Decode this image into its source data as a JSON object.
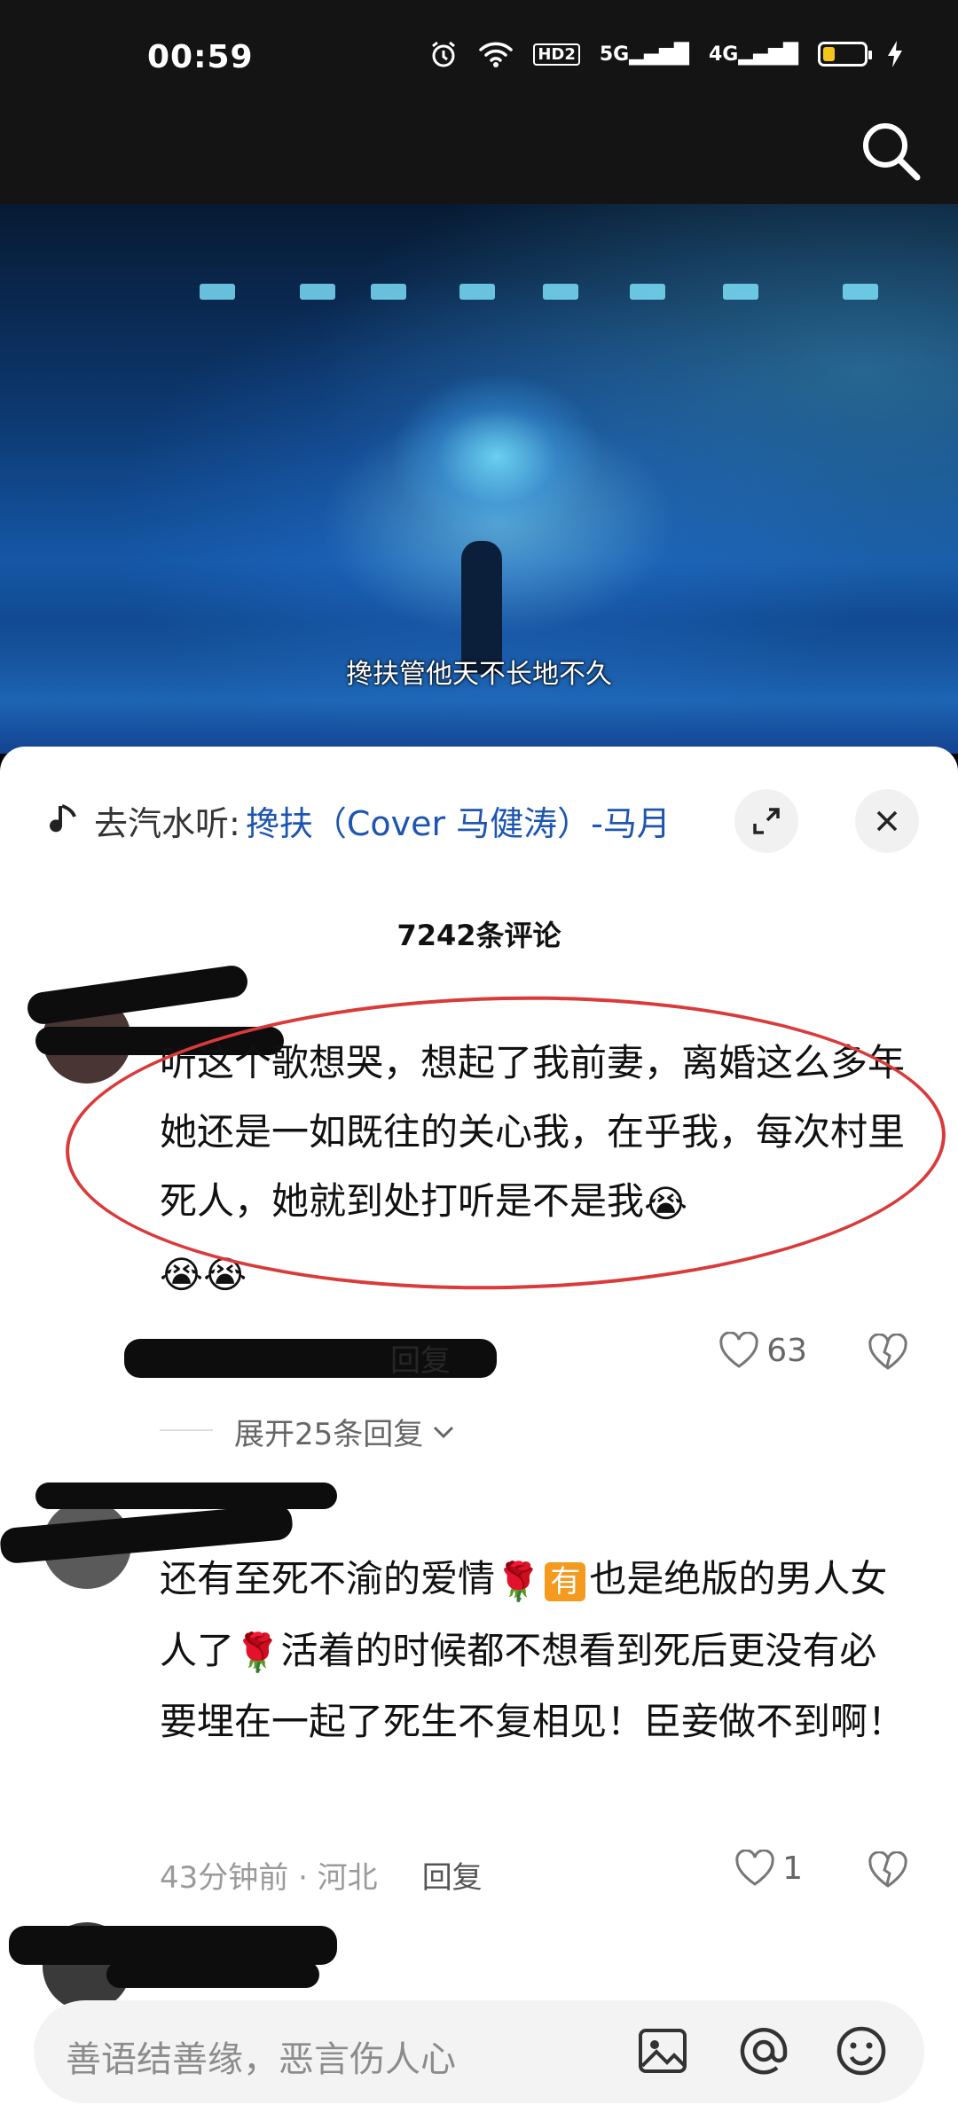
{
  "status": {
    "time": "00:59",
    "hd": "HD2",
    "net1": "5G",
    "net2": "4G",
    "battery_level": 0.3
  },
  "video": {
    "subtitle": "搀扶管他天不长地不久"
  },
  "music": {
    "prefix": "去汽水听:",
    "title": "搀扶（Cover 马健涛）-马月"
  },
  "comments": {
    "count_label": "7242条评论",
    "items": [
      {
        "text": "听这个歌想哭，想起了我前妻，离婚这么多年她还是一如既往的关心我，在乎我，每次村里死人，她就到处打听是不是我",
        "likes": "63",
        "reply_label": "回复",
        "expand_label": "展开25条回复"
      },
      {
        "text_1": "还有至死不渝的爱情",
        "text_2": "也是绝版的男人女人了",
        "text_3": "活着的时候都不想看到死后更没有必要埋在一起了死生不复相见！臣妾做不到啊！",
        "you_badge": "有",
        "time": "43分钟前 · 河北",
        "reply_label": "回复",
        "likes": "1"
      }
    ]
  },
  "input": {
    "placeholder": "善语结善缘，恶言伤人心"
  }
}
